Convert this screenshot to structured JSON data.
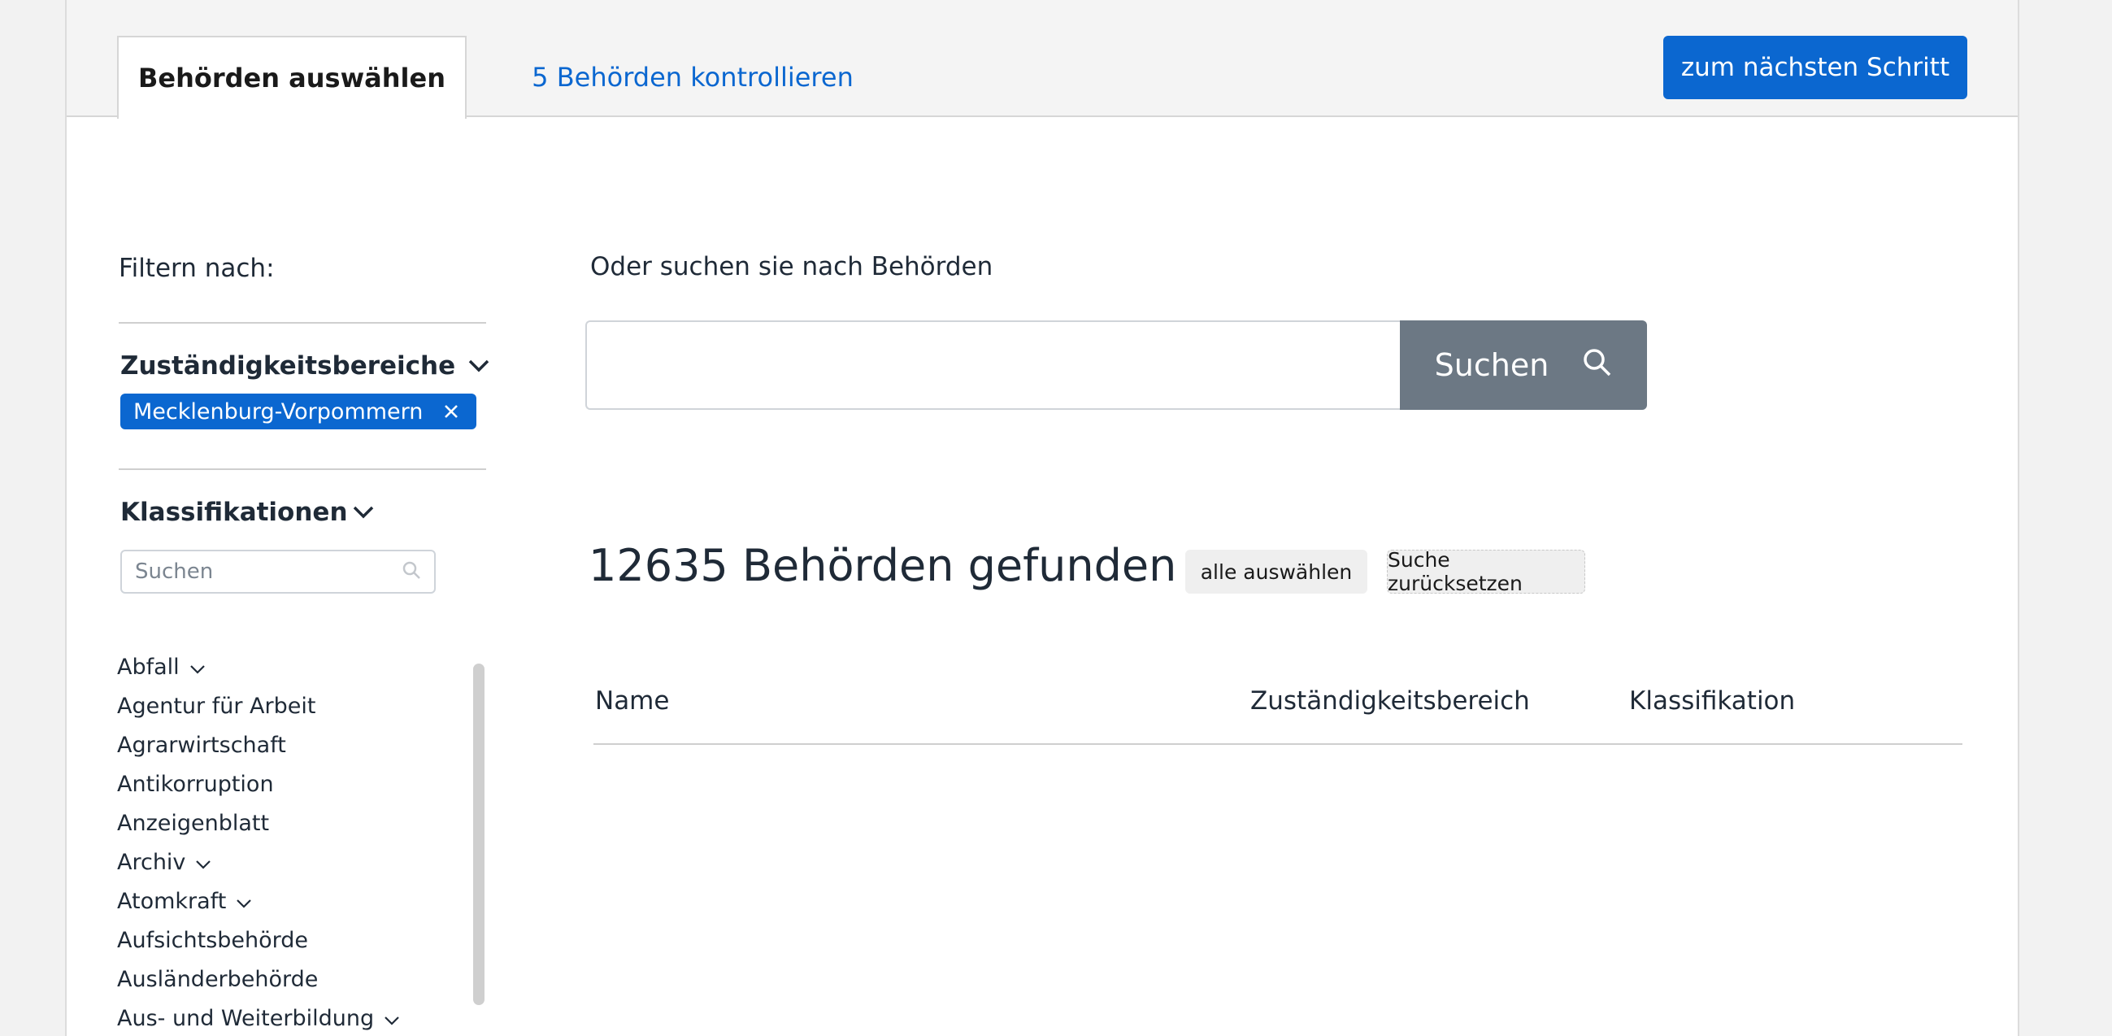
{
  "tabs": {
    "active_label": "Behörden auswählen",
    "second_label": "5 Behörden kontrollieren"
  },
  "next_button_label": "zum nächsten Schritt",
  "sidebar": {
    "filter_label": "Filtern nach:",
    "jurisdiction_title": "Zuständigkeitsbereiche",
    "active_chip": "Mecklenburg-Vorpommern",
    "classification_title": "Klassifikationen",
    "classification_search_placeholder": "Suchen",
    "classifications": [
      {
        "label": "Abfall",
        "expandable": true
      },
      {
        "label": "Agentur für Arbeit",
        "expandable": false
      },
      {
        "label": "Agrarwirtschaft",
        "expandable": false
      },
      {
        "label": "Antikorruption",
        "expandable": false
      },
      {
        "label": "Anzeigenblatt",
        "expandable": false
      },
      {
        "label": "Archiv",
        "expandable": true
      },
      {
        "label": "Atomkraft",
        "expandable": true
      },
      {
        "label": "Aufsichtsbehörde",
        "expandable": false
      },
      {
        "label": "Ausländerbehörde",
        "expandable": false
      },
      {
        "label": "Aus- und Weiterbildung",
        "expandable": true
      }
    ]
  },
  "main": {
    "search_hint": "Oder suchen sie nach Behörden",
    "search_value": "",
    "search_button_label": "Suchen",
    "result_count_text": "12635 Behörden gefunden",
    "select_all_label": "alle auswählen",
    "reset_label": "Suche zurücksetzen",
    "columns": [
      "Name",
      "Zuständigkeitsbereich",
      "Klassifikation"
    ]
  },
  "colors": {
    "accent": "#0b67d0",
    "search_button": "#6c7884"
  }
}
